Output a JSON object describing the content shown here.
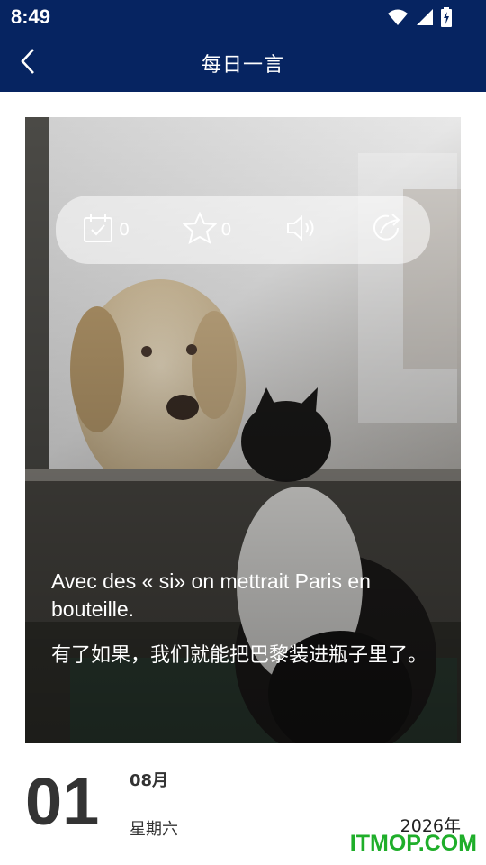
{
  "status_bar": {
    "time": "8:49"
  },
  "app_bar": {
    "title": "每日一言",
    "back_icon": "chevron-left-icon"
  },
  "colors": {
    "header_bg": "#062461",
    "watermark": "#1fae2a"
  },
  "card": {
    "photo_alt": "dog behind window and cat sitting",
    "actions": [
      {
        "icon": "calendar-check-icon",
        "count": "0"
      },
      {
        "icon": "star-icon",
        "count": "0"
      },
      {
        "icon": "speaker-icon",
        "count": ""
      },
      {
        "icon": "share-icon",
        "count": ""
      }
    ],
    "quote_fr": "Avec des « si» on mettrait Paris en bouteille.",
    "quote_zh": "有了如果，我们就能把巴黎装进瓶子里了。"
  },
  "date": {
    "day": "01",
    "month": "08月",
    "weekday": "星期六",
    "year": "2026年"
  },
  "watermark": "ITMOP.COM"
}
